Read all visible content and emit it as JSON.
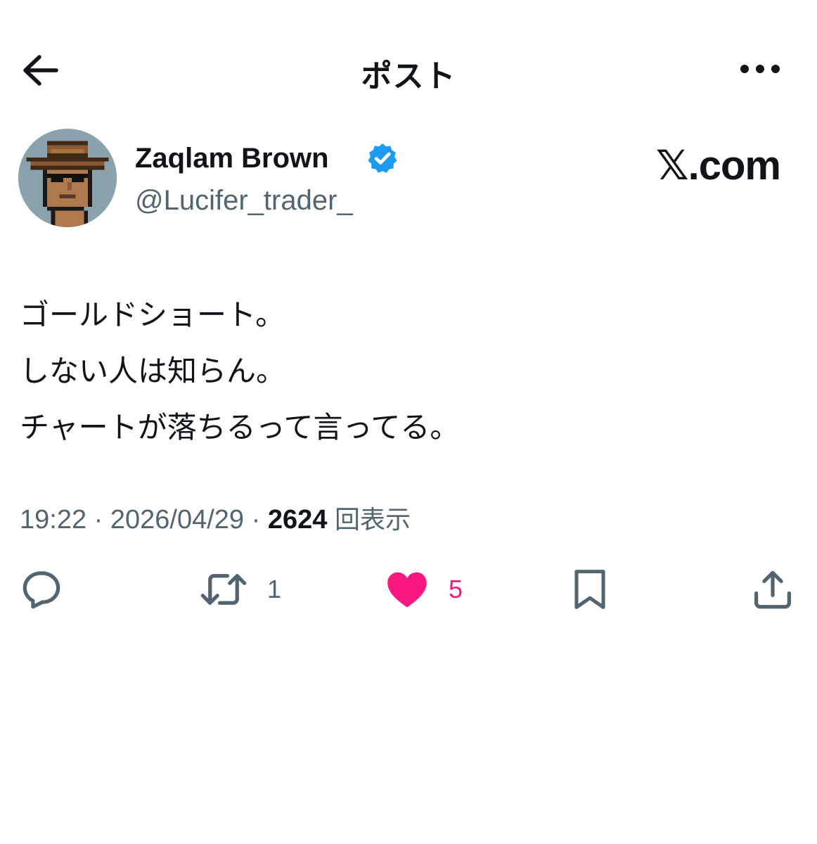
{
  "header": {
    "title": "ポスト",
    "back_icon": "arrow-left-icon",
    "more_icon": "more-horizontal-icon"
  },
  "author": {
    "display_name": "Zaqlam Brown",
    "handle": "@Lucifer_trader_",
    "verified": true,
    "verified_color": "#1d9bf0",
    "avatar": "pixel-art-cowboy-avatar"
  },
  "brand_watermark": "𝕏.com",
  "post": {
    "lines": [
      "ゴールドショート。",
      "しない人は知らん。",
      "チャートが落ちるって言ってる。"
    ],
    "time": "19:22",
    "separator": "·",
    "date": "2026/04/29",
    "views_count": "2624",
    "views_label": "回表示"
  },
  "actions": {
    "reply": {
      "icon": "reply-icon",
      "count": ""
    },
    "repost": {
      "icon": "repost-icon",
      "count": "1"
    },
    "like": {
      "icon": "heart-icon",
      "count": "5",
      "active": true,
      "color": "#f91880"
    },
    "bookmark": {
      "icon": "bookmark-icon"
    },
    "share": {
      "icon": "share-icon"
    }
  },
  "colors": {
    "text_primary": "#0f1419",
    "text_secondary": "#536471",
    "background": "#ffffff"
  }
}
